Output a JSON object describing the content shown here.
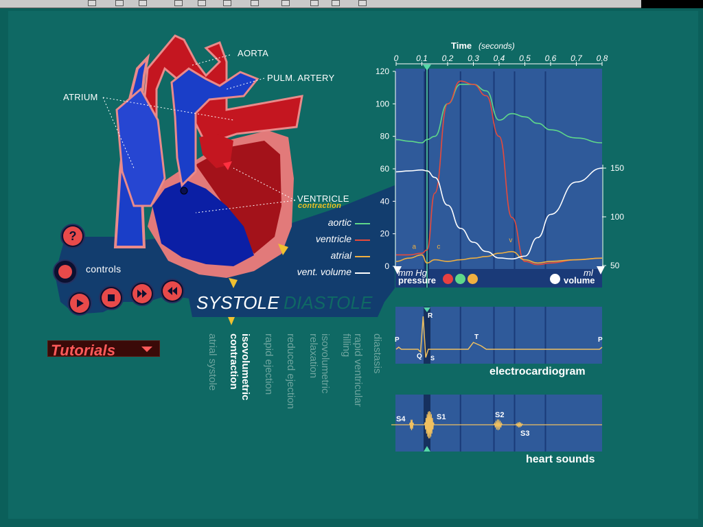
{
  "heart_labels": {
    "aorta": "AORTA",
    "pulm_artery": "PULM. ARTERY",
    "atrium": "ATRIUM",
    "ventricle": "VENTRICLE",
    "contraction": "contraction"
  },
  "controls": {
    "label": "controls"
  },
  "tutorials": {
    "label": "Tutorials"
  },
  "phases": {
    "systole": "SYSTOLE",
    "diastole": "DIASTOLE",
    "items": [
      {
        "line1": "atrial systole",
        "line2": ""
      },
      {
        "line1": "isovolumetric",
        "line2": "contraction"
      },
      {
        "line1": "rapid ejection",
        "line2": ""
      },
      {
        "line1": "reduced ejection",
        "line2": ""
      },
      {
        "line1": "isovolumetric",
        "line2": "relaxation"
      },
      {
        "line1": "rapid ventricular",
        "line2": "filling"
      },
      {
        "line1": "diastasis",
        "line2": ""
      }
    ]
  },
  "pressure_chart": {
    "time_label": "Time",
    "time_unit": "(seconds)",
    "time_ticks": [
      "0",
      "0.1",
      "0.2",
      "0.3",
      "0.4",
      "0.5",
      "0.6",
      "0.7",
      "0.8"
    ],
    "pressure_ticks": [
      "120",
      "100",
      "80",
      "60",
      "40",
      "20",
      "0"
    ],
    "volume_ticks": [
      "150",
      "100",
      "50"
    ],
    "pressure_unit": "mm Hg",
    "volume_unit": "ml",
    "pressure_caption": "pressure",
    "volume_caption": "volume",
    "wave_labels": {
      "a": "a",
      "c": "c",
      "v": "v"
    },
    "legend": [
      {
        "label": "aortic",
        "color": "#5fd88a"
      },
      {
        "label": "ventricle",
        "color": "#e84a3a"
      },
      {
        "label": "atrial",
        "color": "#f0b040"
      },
      {
        "label": "vent. volume",
        "color": "#ffffff"
      }
    ]
  },
  "ecg": {
    "caption": "electrocardiogram",
    "labels": {
      "p1": "P",
      "r": "R",
      "q": "Q",
      "s": "S",
      "t": "T",
      "p2": "P"
    }
  },
  "sounds": {
    "caption": "heart sounds",
    "labels": {
      "s4": "S4",
      "s1": "S1",
      "s2": "S2",
      "s3": "S3"
    }
  },
  "chart_data": {
    "type": "line",
    "title": "",
    "xlabel": "Time (seconds)",
    "ylabel": "mm Hg",
    "y2label": "ml",
    "xlim": [
      0,
      0.8
    ],
    "ylim": [
      0,
      120
    ],
    "y2lim": [
      50,
      150
    ],
    "x": [
      0,
      0.05,
      0.1,
      0.12,
      0.15,
      0.2,
      0.25,
      0.3,
      0.35,
      0.4,
      0.45,
      0.5,
      0.55,
      0.6,
      0.7,
      0.8
    ],
    "series": [
      {
        "name": "aortic",
        "axis": "left",
        "values": [
          78,
          77,
          76,
          78,
          80,
          100,
          112,
          112,
          108,
          90,
          94,
          92,
          88,
          84,
          79,
          76
        ]
      },
      {
        "name": "ventricle",
        "axis": "left",
        "values": [
          7,
          7,
          8,
          10,
          45,
          100,
          114,
          112,
          105,
          80,
          30,
          3,
          1,
          2,
          4,
          5
        ]
      },
      {
        "name": "atrial",
        "axis": "left",
        "values": [
          3,
          5,
          7,
          2,
          4,
          3,
          4,
          5,
          6,
          8,
          9,
          4,
          2,
          3,
          4,
          5
        ]
      },
      {
        "name": "vent. volume",
        "axis": "right",
        "values": [
          146,
          147,
          148,
          147,
          140,
          110,
          85,
          70,
          60,
          53,
          52,
          55,
          75,
          100,
          135,
          150
        ]
      }
    ]
  }
}
